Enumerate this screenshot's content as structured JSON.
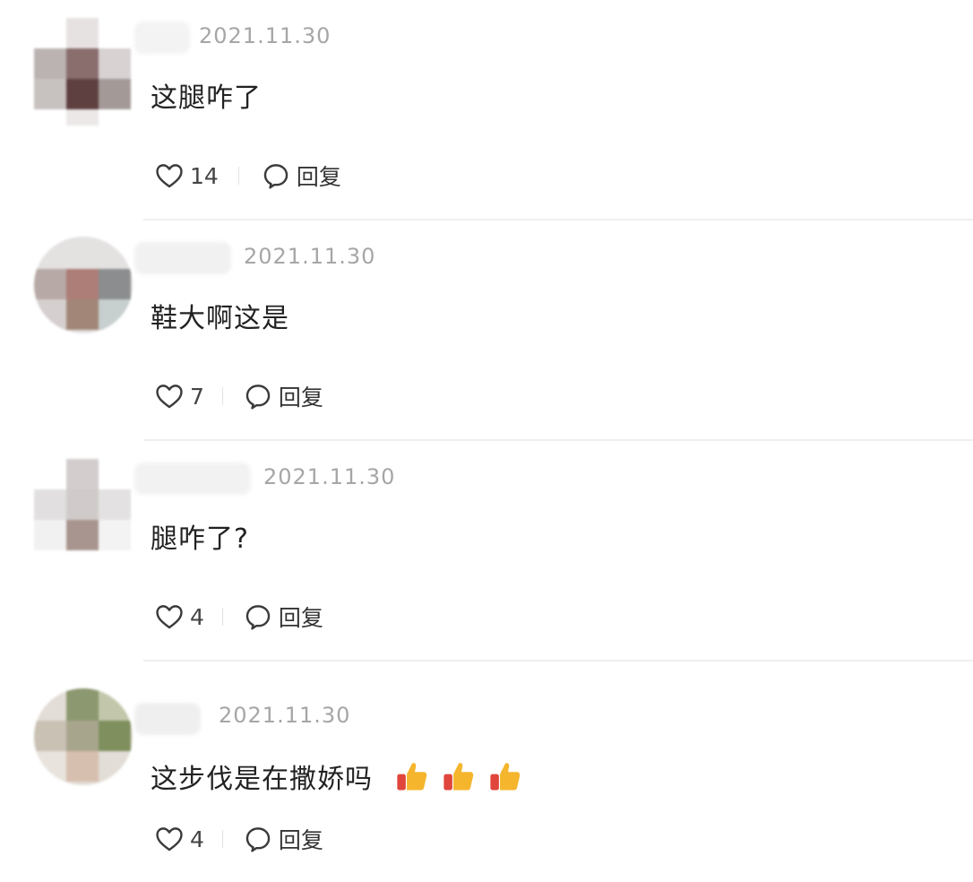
{
  "comments": [
    {
      "date": "2021.11.30",
      "text": "这腿咋了",
      "likes": "14",
      "reply_label": "回复",
      "emojis": []
    },
    {
      "date": "2021.11.30",
      "text": "鞋大啊这是",
      "likes": "7",
      "reply_label": "回复",
      "emojis": []
    },
    {
      "date": "2021.11.30",
      "text": "腿咋了?",
      "likes": "4",
      "reply_label": "回复",
      "emojis": []
    },
    {
      "date": "2021.11.30",
      "text": "这步伐是在撒娇吗",
      "likes": "4",
      "reply_label": "回复",
      "emojis": [
        "thumbs-up",
        "thumbs-up",
        "thumbs-up"
      ]
    }
  ],
  "colors": {
    "date_text": "#a6a6a6",
    "divider": "#efefef",
    "icon_stroke": "#3a3a3a",
    "emoji_red": "#e0463b",
    "emoji_yellow": "#f5b52d"
  },
  "icons": {
    "like": "heart-outline-icon",
    "reply": "speech-bubble-icon",
    "emoji": "thumbs-up-emoji"
  }
}
